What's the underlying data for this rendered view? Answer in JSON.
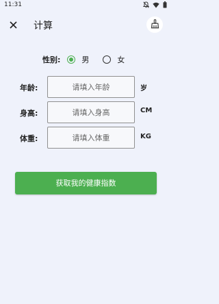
{
  "status_bar": {
    "time": "11:31",
    "icons": [
      "notifications-off-icon",
      "wifi-icon",
      "battery-icon"
    ]
  },
  "app_bar": {
    "title": "计算",
    "close_icon": "close-icon",
    "action_icon": "broom-icon"
  },
  "gender": {
    "label": "性别:",
    "options": [
      {
        "label": "男",
        "selected": true
      },
      {
        "label": "女",
        "selected": false
      }
    ]
  },
  "form": {
    "age": {
      "label": "年龄:",
      "placeholder": "请填入年龄",
      "value": "",
      "unit": "岁"
    },
    "height": {
      "label": "身高:",
      "placeholder": "请填入身高",
      "value": "",
      "unit": "CM"
    },
    "weight": {
      "label": "体重:",
      "placeholder": "请填入体重",
      "value": "",
      "unit": "KG"
    }
  },
  "submit_label": "获取我的健康指数",
  "colors": {
    "accent": "#4caf50",
    "background": "#eff2fb"
  }
}
